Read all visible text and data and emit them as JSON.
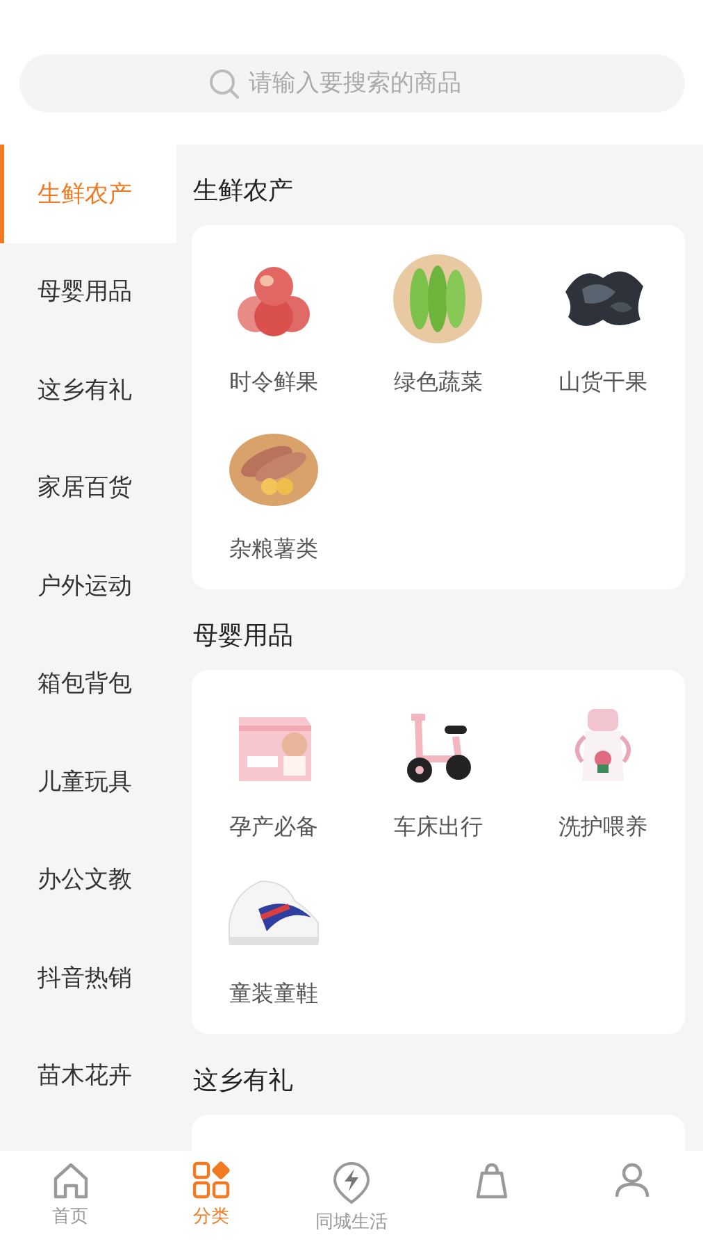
{
  "search": {
    "placeholder": "请输入要搜索的商品"
  },
  "sidebar": {
    "items": [
      {
        "label": "生鲜农产",
        "selected": true
      },
      {
        "label": "母婴用品",
        "selected": false
      },
      {
        "label": "这乡有礼",
        "selected": false
      },
      {
        "label": "家居百货",
        "selected": false
      },
      {
        "label": "户外运动",
        "selected": false
      },
      {
        "label": "箱包背包",
        "selected": false
      },
      {
        "label": "儿童玩具",
        "selected": false
      },
      {
        "label": "办公文教",
        "selected": false
      },
      {
        "label": "抖音热销",
        "selected": false
      },
      {
        "label": "苗木花卉",
        "selected": false
      }
    ]
  },
  "sections": [
    {
      "title": "生鲜农产",
      "items": [
        {
          "label": "时令鲜果",
          "kind": "picture"
        },
        {
          "label": "绿色蔬菜",
          "kind": "picture"
        },
        {
          "label": "山货干果",
          "kind": "picture"
        },
        {
          "label": "杂粮薯类",
          "kind": "picture"
        }
      ]
    },
    {
      "title": "母婴用品",
      "items": [
        {
          "label": "孕产必备",
          "kind": "picture"
        },
        {
          "label": "车床出行",
          "kind": "picture"
        },
        {
          "label": "洗护喂养",
          "kind": "picture"
        },
        {
          "label": "童装童鞋",
          "kind": "picture"
        }
      ]
    },
    {
      "title": "这乡有礼"
    }
  ],
  "tab_bar": {
    "items": [
      {
        "label": "首页",
        "selected": false
      },
      {
        "label": "分类",
        "selected": true
      },
      {
        "label": "同城生活",
        "selected": false
      },
      {
        "selected": false
      },
      {
        "selected": false
      }
    ]
  }
}
